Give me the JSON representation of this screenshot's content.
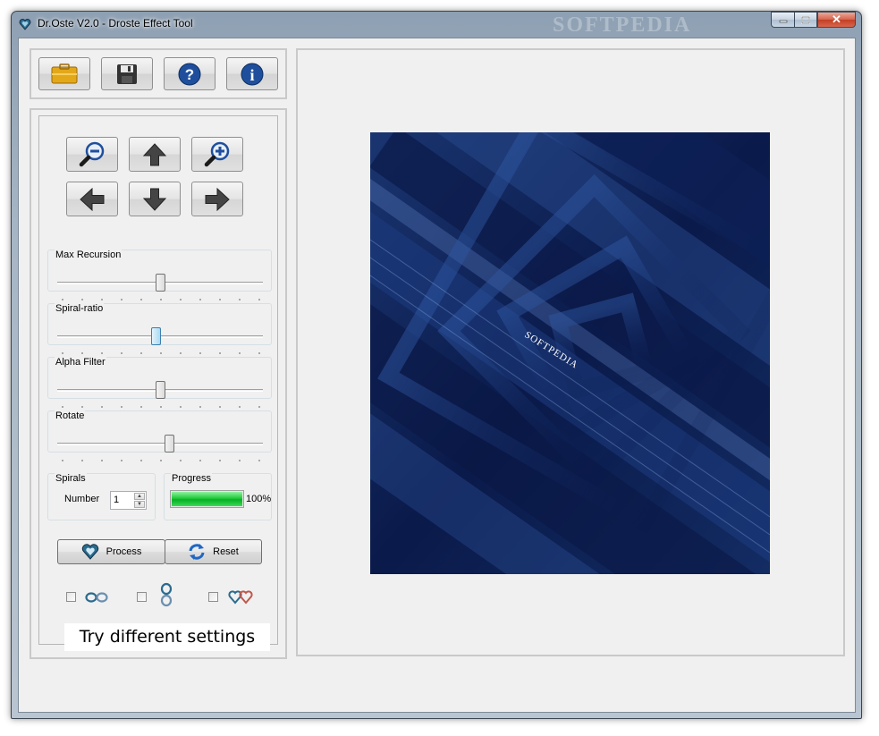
{
  "window": {
    "title": "Dr.Oste V2.0 - Droste Effect Tool",
    "watermark": "SOFTPEDIA",
    "close_glyph": "✕"
  },
  "toolbar": {
    "buttons": [
      {
        "name": "open",
        "icon": "folder-icon"
      },
      {
        "name": "save",
        "icon": "floppy-disk-icon"
      },
      {
        "name": "help",
        "icon": "question-icon"
      },
      {
        "name": "about",
        "icon": "info-icon"
      }
    ]
  },
  "navigation": {
    "buttons": [
      "zoom-out",
      "move-up",
      "zoom-in",
      "move-left",
      "move-down",
      "move-right"
    ]
  },
  "sliders": [
    {
      "key": "max_recursion",
      "label": "Max Recursion",
      "value": 0.5,
      "active": false
    },
    {
      "key": "spiral_ratio",
      "label": "Spiral-ratio",
      "value": 0.48,
      "active": true
    },
    {
      "key": "alpha_filter",
      "label": "Alpha Filter",
      "value": 0.5,
      "active": false
    },
    {
      "key": "rotate",
      "label": "Rotate",
      "value": 0.55,
      "active": false
    }
  ],
  "spirals": {
    "group_label": "Spirals",
    "number_label": "Number",
    "number_value": "1"
  },
  "progress": {
    "group_label": "Progress",
    "percent": 100,
    "percent_text": "100%"
  },
  "actions": {
    "process_label": "Process",
    "reset_label": "Reset"
  },
  "options": [
    {
      "name": "infinity-mode",
      "checked": false
    },
    {
      "name": "figure-eight-mode",
      "checked": false
    },
    {
      "name": "double-heart-mode",
      "checked": false
    }
  ],
  "caption": "Try different settings",
  "preview": {
    "overlay_text": "SOFTPEDIA"
  },
  "colors": {
    "progress_green": "#06b025",
    "preview_dark": "#0a1a4a",
    "preview_mid": "#22407e",
    "icon_blue": "#1f4f9c"
  }
}
